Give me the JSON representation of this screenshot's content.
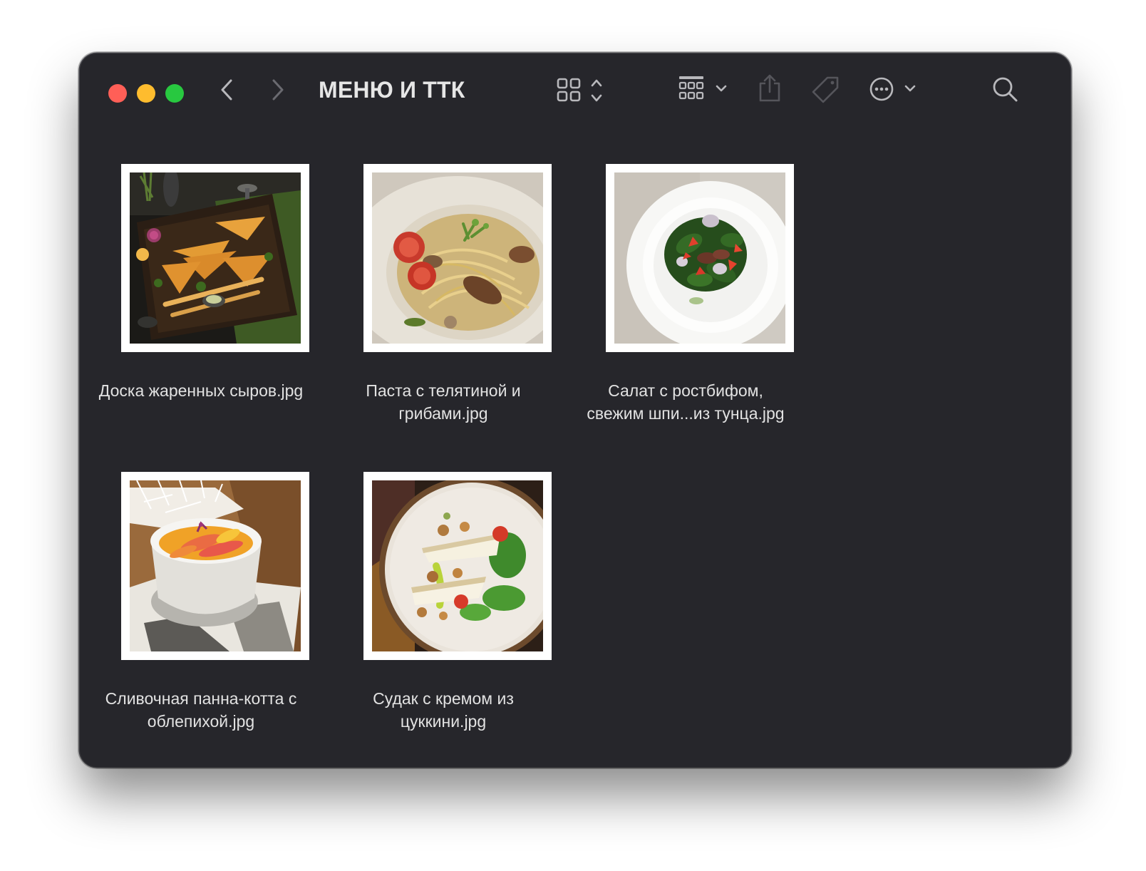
{
  "window": {
    "title": "МЕНЮ И ТТК"
  },
  "toolbar": {
    "icons": [
      "back-icon",
      "forward-icon",
      "icon-view-icon",
      "group-icon",
      "share-icon",
      "tag-icon",
      "more-icon",
      "search-icon"
    ]
  },
  "files": [
    {
      "name_line1": "Доска жаренных сыров.jpg",
      "name_line2": ""
    },
    {
      "name_line1": "Паста с телятиной и",
      "name_line2": "грибами.jpg"
    },
    {
      "name_line1": "Салат с ростбифом,",
      "name_line2": "свежим шпи...из тунца.jpg"
    },
    {
      "name_line1": "Сливочная панна-котта с",
      "name_line2": "облепихой.jpg"
    },
    {
      "name_line1": "Судак с кремом из",
      "name_line2": "цуккини.jpg"
    }
  ],
  "colors": {
    "window_bg": "#26262b",
    "close": "#ff5f57",
    "minimize": "#febc2e",
    "zoom": "#28c840"
  }
}
